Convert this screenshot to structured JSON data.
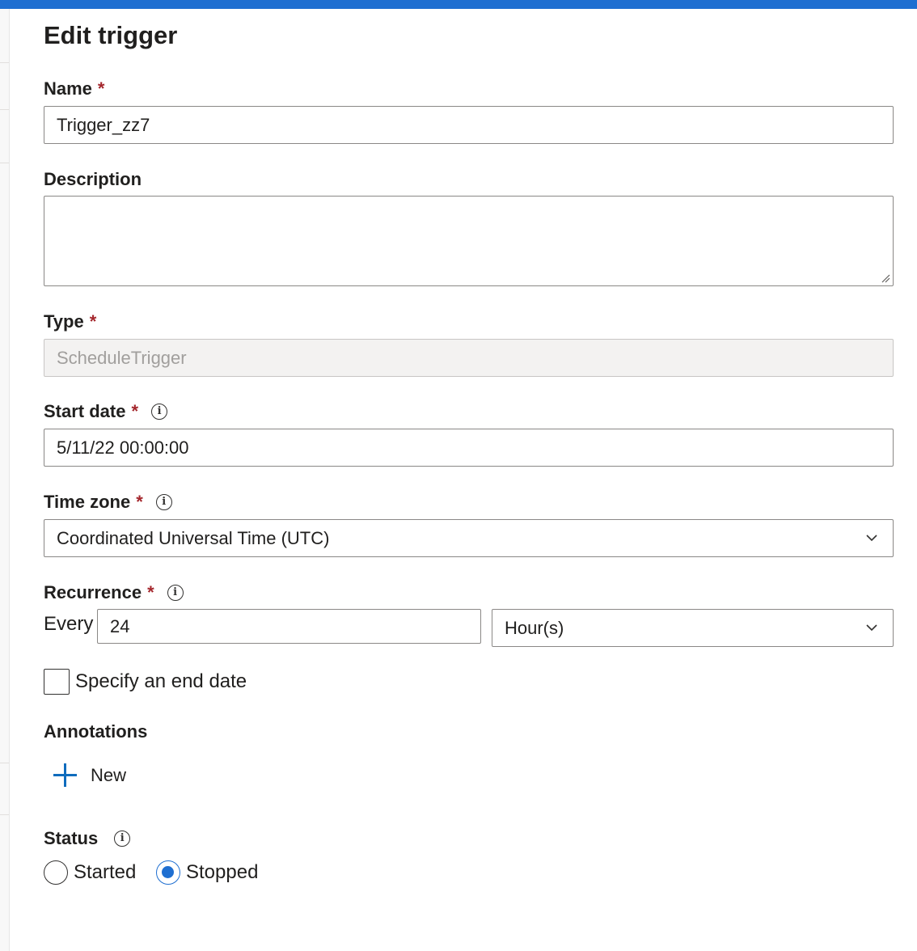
{
  "form": {
    "title": "Edit trigger",
    "required_marker": "*",
    "name": {
      "label": "Name",
      "value": "Trigger_zz7"
    },
    "description": {
      "label": "Description",
      "value": ""
    },
    "type": {
      "label": "Type",
      "value": "ScheduleTrigger"
    },
    "start_date": {
      "label": "Start date",
      "value": "5/11/22 00:00:00"
    },
    "time_zone": {
      "label": "Time zone",
      "value": "Coordinated Universal Time (UTC)"
    },
    "recurrence": {
      "label": "Recurrence",
      "every_label": "Every",
      "interval": "24",
      "unit": "Hour(s)"
    },
    "end_date": {
      "label": "Specify an end date",
      "checked": false
    },
    "annotations": {
      "label": "Annotations",
      "new_label": "New"
    },
    "status": {
      "label": "Status",
      "options": [
        "Started",
        "Stopped"
      ],
      "selected": "Stopped"
    },
    "info_icon_glyph": "i"
  },
  "icons": [
    "info-icon",
    "chevron-down-icon",
    "plus-icon",
    "resize-handle-icon"
  ],
  "colors": {
    "accent": "#1f6fd1",
    "required": "#a4262c",
    "border": "#8a8886"
  }
}
